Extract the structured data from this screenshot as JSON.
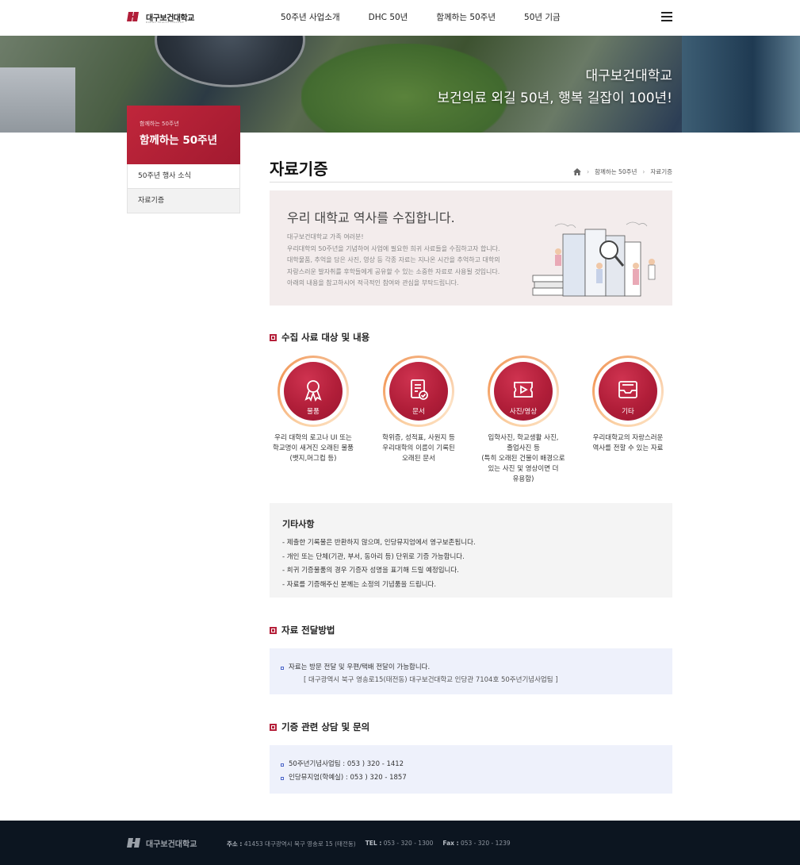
{
  "header": {
    "logo_text": "대구보건대학교",
    "logo_sub": "DAEGU HEALTH COLLEGE",
    "nav": [
      "50주년 사업소개",
      "DHC 50년",
      "함께하는 50주년",
      "50년 기금"
    ]
  },
  "hero": {
    "line1": "대구보건대학교",
    "line2": "보건의료 외길 50년, 행복 길잡이 100년!"
  },
  "side": {
    "sub": "함께하는 50주년",
    "title": "함께하는 50주년",
    "items": [
      "50주년 행사 소식",
      "자료기증"
    ]
  },
  "page": {
    "title": "자료기증",
    "breadcrumb": [
      "함께하는 50주년",
      "자료기증"
    ]
  },
  "intro": {
    "title": "우리 대학교 역사를 수집합니다.",
    "lines": [
      "대구보건대학교 가족 여러분!",
      "우리대학의 50주년을 기념하여 사업에 필요한 희귀 사료들을 수집하고자 합니다.",
      "대학물품, 추억을 담은 사진, 영상 등 각종 자료는 지나온 시간을 추억하고 대학의",
      "자랑스러운 발자취를 후학들에게 공유할 수 있는 소중한 자료로 사용될 것입니다.",
      "아래의 내용을 참고하시어 적극적인 참여와 관심을 부탁드립니다."
    ]
  },
  "sections": {
    "items_title": "수집 사료 대상 및 내용",
    "delivery_title": "자료 전달방법",
    "contact_title": "기증 관련 상담 및 문의"
  },
  "items": [
    {
      "label": "물품",
      "icon": "award-ribbon-icon",
      "desc": [
        "우리 대학의 로고나 UI 또는",
        "학교명이 새겨진 오래된 물품",
        "(뱃지,머그컵 등)"
      ]
    },
    {
      "label": "문서",
      "icon": "document-check-icon",
      "desc": [
        "학위증, 성적표, 사원지 등",
        "우리대학의 이름이 기록된",
        "오래된 문서"
      ]
    },
    {
      "label": "사진/영상",
      "icon": "video-play-icon",
      "desc": [
        "입학사진, 학교생활 사진,",
        "졸업사진 등",
        "(특히 오래된 건물이 배경으로",
        "있는 사진 및 영상이면 더",
        "유용함)"
      ]
    },
    {
      "label": "기타",
      "icon": "inbox-tray-icon",
      "desc": [
        "우리대학교의 자랑스러운",
        "역사를 전할 수 있는 자료"
      ]
    }
  ],
  "etc": {
    "title": "기타사항",
    "lines": [
      "- 제출한 기록물은 반환하지 않으며, 인당뮤지엄에서 영구보존됩니다.",
      "- 개인 또는 단체(기관, 부서, 동아리 등) 단위로 기증 가능합니다.",
      "- 희귀 기증물품의 경우 기증자 성명을 표기해 드릴 예정입니다.",
      "- 자료를 기증해주신 분께는 소정의 기념품을 드립니다."
    ]
  },
  "delivery": {
    "line": "자료는 방문 전달 및 우편/택배 전달이 가능합니다.",
    "sub": "[ 대구광역시 북구 영송로15(태전동) 대구보건대학교 인당관 7104호 50주년기념사업팀 ]"
  },
  "contact": {
    "lines": [
      "50주년기념사업팀 : 053 ) 320 - 1412",
      "인당뮤지엄(학예실) : 053 ) 320 - 1857"
    ]
  },
  "footer": {
    "logo_text": "대구보건대학교",
    "addr_label": "주소 :",
    "addr": "41453 대구광역시 북구 영송로 15 (태전동)",
    "tel_label": "TEL :",
    "tel": "053 - 320 - 1300",
    "fax_label": "Fax :",
    "fax": "053 - 320 - 1239"
  },
  "colors": {
    "brand": "#b11e39",
    "accent_ring": "#f39a5c",
    "footer_bg": "#0c1520",
    "info_bg": "#eef1fb"
  }
}
